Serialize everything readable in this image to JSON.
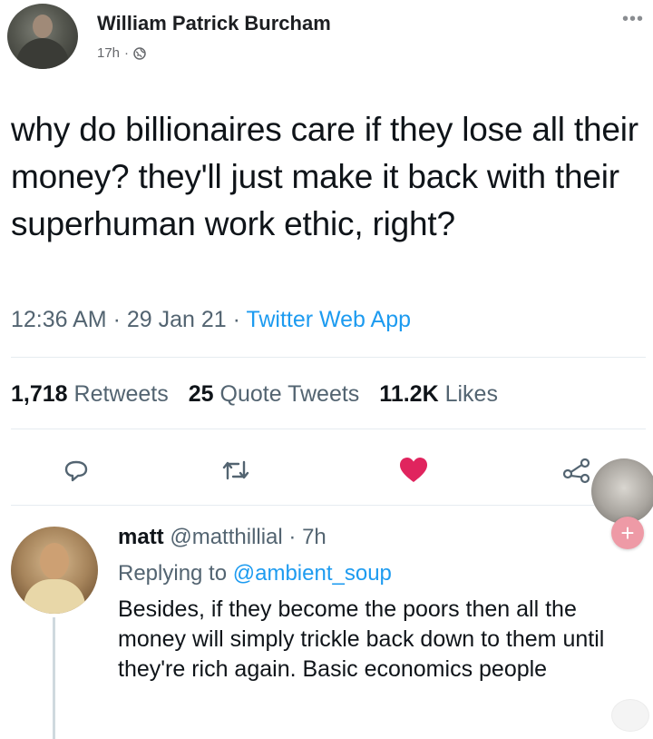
{
  "post": {
    "author": "William Patrick Burcham",
    "time": "17h",
    "separator": "·",
    "more_label": "•••"
  },
  "tweet": {
    "text": "why do billionaires care if they lose all their money? they'll just make it back with their superhuman work ethic, right?",
    "timestamp": "12:36 AM · 29 Jan 21 · ",
    "source": "Twitter Web App",
    "stats": {
      "retweets_count": "1,718",
      "retweets_label": "Retweets",
      "quotes_count": "25",
      "quotes_label": "Quote Tweets",
      "likes_count": "11.2K",
      "likes_label": "Likes"
    }
  },
  "actions": [
    "reply-icon",
    "retweet-icon",
    "heart-icon",
    "share-icon"
  ],
  "colors": {
    "like": "#e0245e",
    "link": "#1d9bf0",
    "fab_plus": "#ee9aa6"
  },
  "reply": {
    "name": "matt",
    "handle": "@matthillial",
    "time": "· 7h",
    "replying_prefix": "Replying to",
    "replying_to": "@ambient_soup",
    "text": "Besides, if they become the poors then all the money will simply trickle back down to them until they're rich again. Basic economics people"
  },
  "fab": {
    "plus_label": "+"
  }
}
